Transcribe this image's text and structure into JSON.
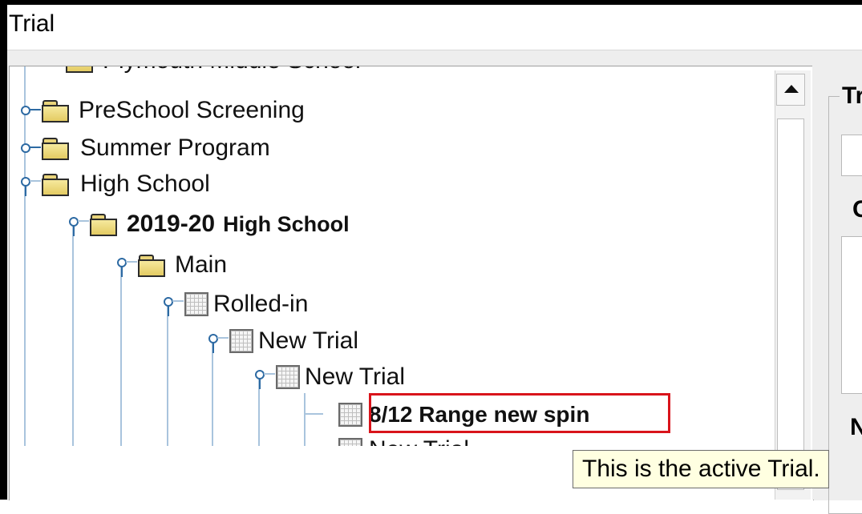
{
  "window": {
    "title": "Trial"
  },
  "tree": {
    "nodes": [
      {
        "label": "Plymouth Middle School",
        "icon": "folder-icon"
      },
      {
        "label": "PreSchool Screening",
        "icon": "folder-icon"
      },
      {
        "label": "Summer Program",
        "icon": "folder-icon"
      },
      {
        "label": "High School",
        "icon": "folder-icon"
      },
      {
        "label_prefix": "2019-20",
        "label_suffix": "High School",
        "icon": "folder-icon"
      },
      {
        "label": "Main",
        "icon": "folder-icon"
      },
      {
        "label": "Rolled-in",
        "icon": "trial-grid-icon"
      },
      {
        "label": "New Trial",
        "icon": "trial-grid-icon"
      },
      {
        "label": "New Trial",
        "icon": "trial-grid-icon"
      },
      {
        "label": "8/12 Range new spin",
        "icon": "trial-grid-icon",
        "active": true
      },
      {
        "label": "New Trial",
        "icon": "trial-grid-icon"
      }
    ]
  },
  "details": {
    "group_title": "Tr",
    "label_c": "C",
    "label_n": "N"
  },
  "tooltip": {
    "text": "This is the active Trial."
  },
  "colors": {
    "highlight": "#d9141b",
    "tooltip_bg": "#ffffe1",
    "connector": "#2d6aa3"
  }
}
